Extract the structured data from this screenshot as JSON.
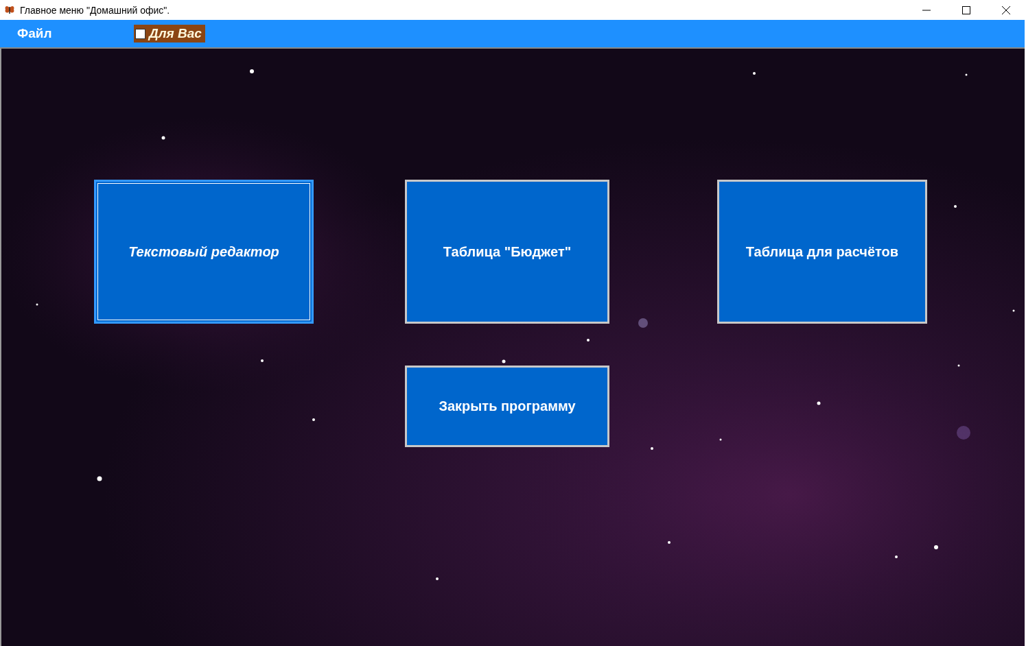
{
  "window": {
    "title": "Главное меню \"Домашний офис\"."
  },
  "menu": {
    "items": [
      {
        "label": "Файл",
        "kind": "menu"
      },
      {
        "label": "Для Вас",
        "kind": "checkbox",
        "checked": false
      }
    ]
  },
  "buttons": [
    {
      "label": "Текстовый редактор",
      "selected": true
    },
    {
      "label": "Таблица \"Бюджет\"",
      "selected": false
    },
    {
      "label": "Таблица для расчётов",
      "selected": false
    },
    {
      "label": "Закрыть программу",
      "selected": false
    }
  ]
}
